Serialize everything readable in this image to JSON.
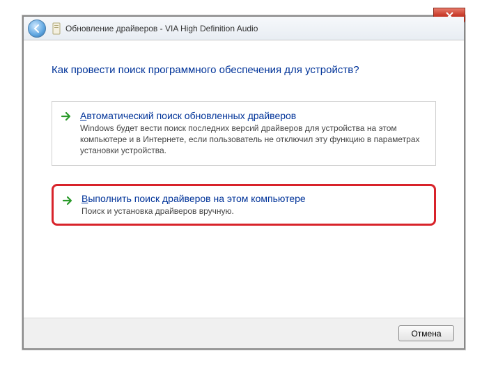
{
  "window": {
    "title": "Обновление драйверов - VIA High Definition Audio"
  },
  "heading": "Как провести поиск программного обеспечения для устройств?",
  "options": [
    {
      "title_prefix": "А",
      "title_rest": "втоматический поиск обновленных драйверов",
      "desc": "Windows будет вести поиск последних версий драйверов для устройства на этом компьютере и в Интернете, если пользователь не отключил эту функцию в параметрах установки устройства."
    },
    {
      "title_prefix": "В",
      "title_rest": "ыполнить поиск драйверов на этом компьютере",
      "desc": "Поиск и установка драйверов вручную."
    }
  ],
  "footer": {
    "cancel": "Отмена"
  }
}
